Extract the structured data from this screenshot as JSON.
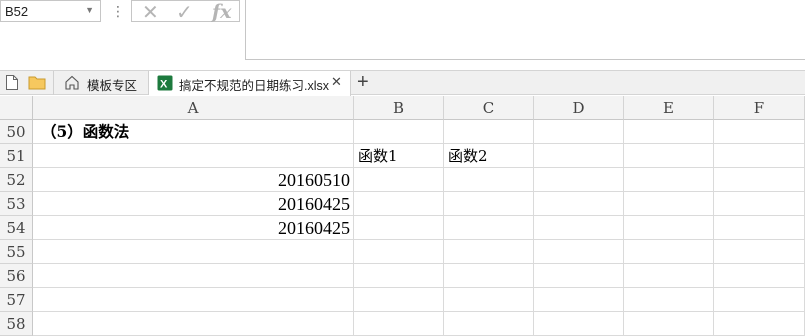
{
  "formula_bar": {
    "name_box": "B52",
    "formula_value": ""
  },
  "tabs": {
    "template_tab_label": "模板专区",
    "file_tab_label": "搞定不规范的日期练习.xlsx",
    "close_glyph": "✕",
    "new_tab_glyph": "+"
  },
  "columns": [
    "A",
    "B",
    "C",
    "D",
    "E",
    "F"
  ],
  "rows": [
    {
      "num": "50",
      "A": "（5）函数法",
      "B": "",
      "C": ""
    },
    {
      "num": "51",
      "A": "",
      "B": "函数1",
      "C": "函数2"
    },
    {
      "num": "52",
      "A": "20160510",
      "B": "",
      "C": ""
    },
    {
      "num": "53",
      "A": "20160425",
      "B": "",
      "C": ""
    },
    {
      "num": "54",
      "A": "20160425",
      "B": "",
      "C": ""
    },
    {
      "num": "55",
      "A": "",
      "B": "",
      "C": ""
    },
    {
      "num": "56",
      "A": "",
      "B": "",
      "C": ""
    },
    {
      "num": "57",
      "A": "",
      "B": "",
      "C": ""
    },
    {
      "num": "58",
      "A": "",
      "B": "",
      "C": ""
    }
  ],
  "icons": {
    "cancel": "✕",
    "enter": "✓",
    "function": "fx",
    "dropdown": "▼",
    "more": "⋮"
  }
}
